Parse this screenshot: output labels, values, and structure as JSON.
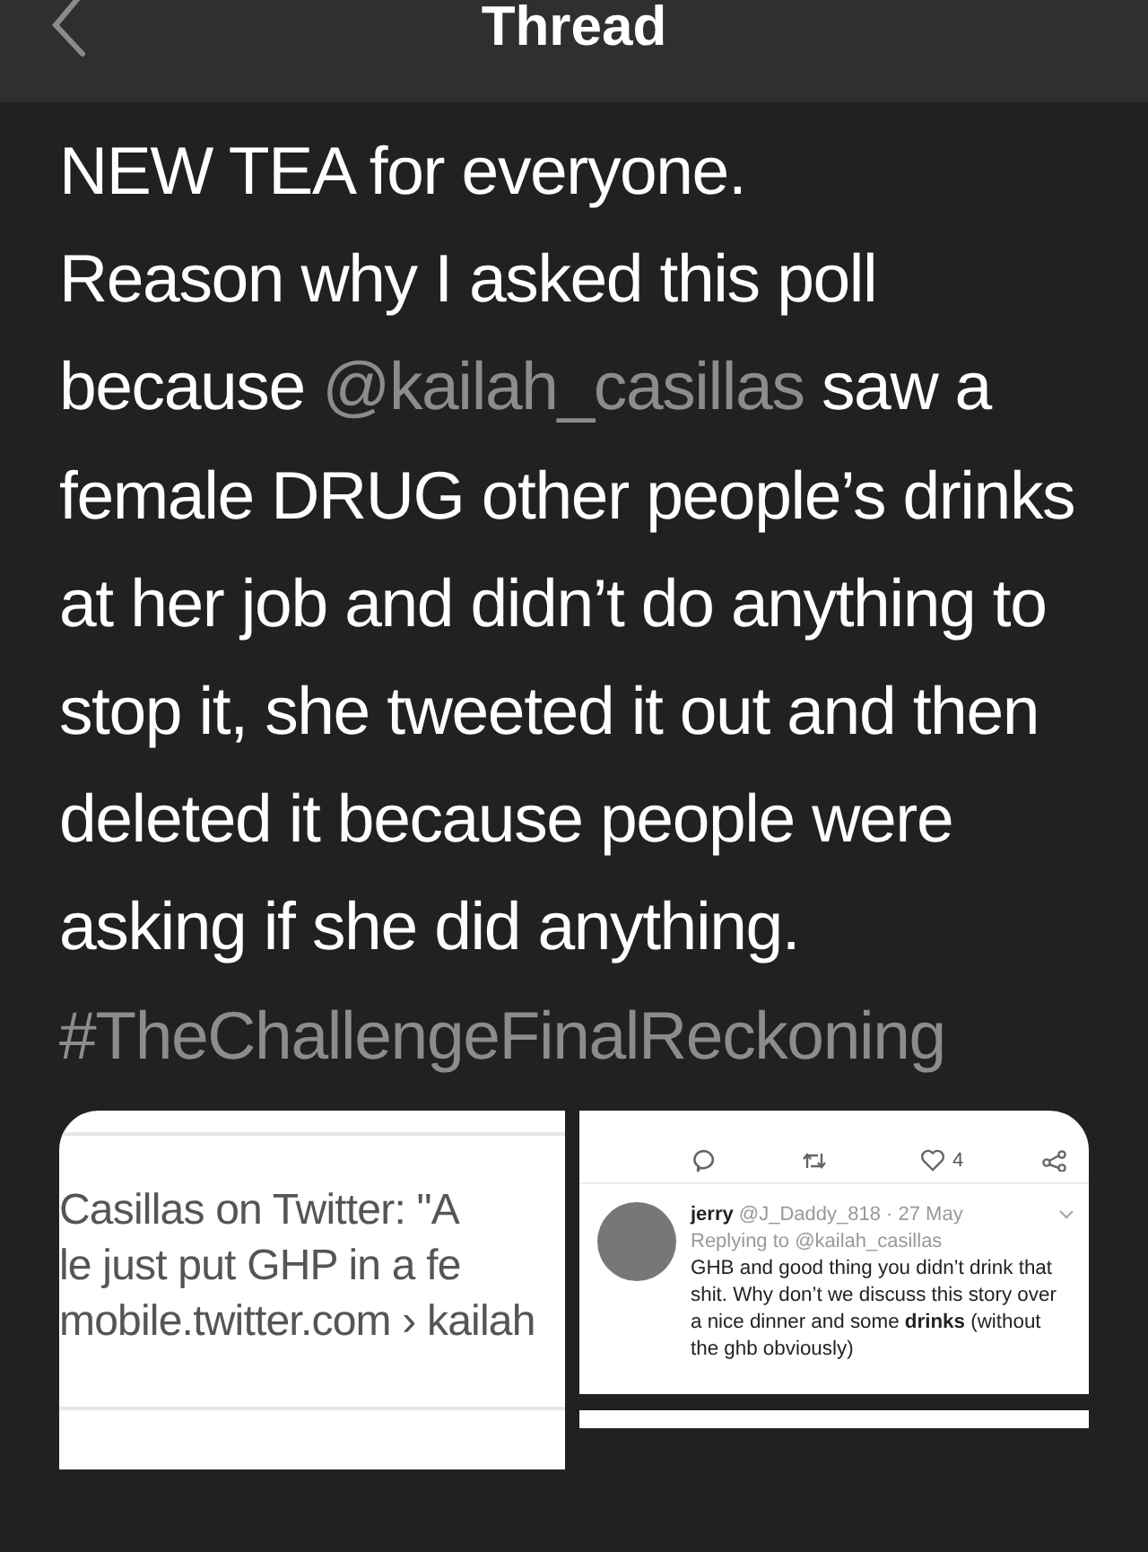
{
  "header": {
    "title": "Thread"
  },
  "post": {
    "text_before": "NEW TEA for everyone.\nReason why I asked this poll because ",
    "mention": "@kailah_casillas",
    "text_after": " saw a female DRUG other people’s drinks at her job and didn’t do anything to stop it, she tweeted it out and then deleted it because people were asking if she did anything.",
    "hashtag": "#TheChallengeFinalReckoning"
  },
  "link_preview": {
    "lines": [
      "Casillas on Twitter: \"A",
      "le just put GHP in a fe"
    ],
    "domain": "mobile.twitter.com › kailah"
  },
  "tweet_screenshot": {
    "likes": "4",
    "name": "jerry",
    "handle": "@J_Daddy_818 · 27 May",
    "replying": "Replying to @kailah_casillas",
    "text": "GHB and good thing you didn’t drink that shit. Why don’t we discuss this story over a nice dinner and some **drinks** (without the ghb obviously)"
  }
}
